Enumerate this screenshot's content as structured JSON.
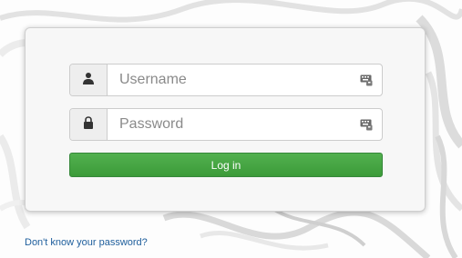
{
  "login": {
    "username_placeholder": "Username",
    "password_placeholder": "Password",
    "login_label": "Log in",
    "forgot_label": "Don't know your password?"
  },
  "icons": {
    "username": "user-icon",
    "password": "lock-icon",
    "keyboard": "keyboard-icon"
  },
  "colors": {
    "login_button": "#44a543",
    "link": "#1e5e9c"
  }
}
